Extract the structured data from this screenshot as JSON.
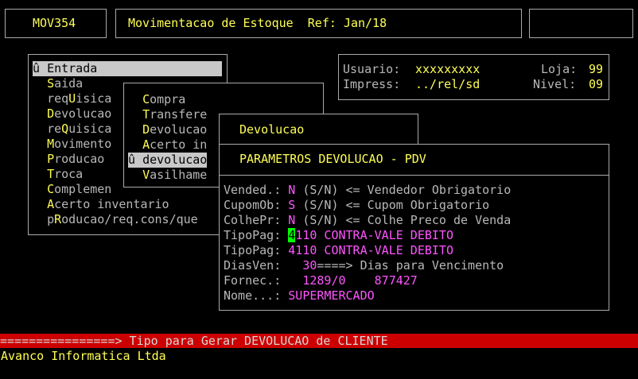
{
  "header": {
    "program_code": "MOV354",
    "title": "Movimentacao de Estoque  Ref: Jan/18"
  },
  "info": {
    "usuario_label": "Usuario:",
    "usuario_value": "xxxxxxxxx",
    "loja_label": "Loja:",
    "loja_value": "99",
    "impress_label": "Impress:",
    "impress_value": "../rel/sd",
    "nivel_label": "Nivel:",
    "nivel_value": "09"
  },
  "main_menu": {
    "items": [
      {
        "marker": "û ",
        "first": "E",
        "rest": "ntrada",
        "selected": true
      },
      {
        "marker": "  ",
        "first": "S",
        "rest": "aida"
      },
      {
        "marker": "  ",
        "first": "",
        "pre": "req",
        "hot": "U",
        "post": "isica"
      },
      {
        "marker": "  ",
        "first": "D",
        "rest": "evolucao"
      },
      {
        "marker": "  ",
        "first": "",
        "pre": "re",
        "hot": "Q",
        "post": "uisica"
      },
      {
        "marker": "  ",
        "first": "M",
        "rest": "ovimento"
      },
      {
        "marker": "  ",
        "first": "P",
        "rest": "roducao"
      },
      {
        "marker": "  ",
        "first": "T",
        "rest": "roca"
      },
      {
        "marker": "  ",
        "first": "C",
        "rest": "omplemen"
      },
      {
        "marker": "  ",
        "first": "A",
        "rest": "certo inventario"
      },
      {
        "marker": "  ",
        "first": "",
        "pre": "p",
        "hot": "R",
        "post": "oducao/req.cons/que"
      }
    ]
  },
  "sub_menu": {
    "items": [
      {
        "first": "C",
        "rest": "ompra"
      },
      {
        "first": "T",
        "rest": "ransfere"
      },
      {
        "first": "D",
        "rest": "evolucao"
      },
      {
        "first": "A",
        "rest": "certo in"
      },
      {
        "marker": "û ",
        "first": "d",
        "rest": "evolucao",
        "selected": true
      },
      {
        "first": "V",
        "rest": "asilhame"
      }
    ]
  },
  "devolucao_popup": {
    "title": "Devolucao"
  },
  "params": {
    "title": "PARAMETROS DEVOLUCAO - PDV",
    "rows": [
      {
        "label": "Vended.:",
        "value": "N",
        "desc": " (S/N) <= Vendedor Obrigatorio"
      },
      {
        "label": "CupomOb:",
        "value": "S",
        "desc": " (S/N) <= Cupom Obrigatorio"
      },
      {
        "label": "ColhePr:",
        "value": "N",
        "desc": " (S/N) <= Colhe Preco de Venda"
      },
      {
        "label": "TipoPag:",
        "cursor": "4",
        "value": "110 CONTRA-VALE DEBITO"
      },
      {
        "label": "TipoPag:",
        "value": "4110 CONTRA-VALE DEBITO"
      },
      {
        "label": "DiasVen:",
        "value": "30",
        "desc": "====> Dias para Vencimento"
      },
      {
        "label": "Fornec.:",
        "value": "1289/0    877427"
      },
      {
        "label": "Nome...:",
        "value": "SUPERMERCADO"
      }
    ]
  },
  "status_bar": {
    "text": "================> Tipo para Gerar DEVOLUCAO de CLIENTE"
  },
  "footer": {
    "company": "Avanco Informatica Ltda"
  },
  "colors": {
    "background": "#000000",
    "yellow": "#ffff55",
    "magenta": "#ff55ff",
    "status_bar": "#cc0000",
    "cursor": "#00ff00"
  }
}
